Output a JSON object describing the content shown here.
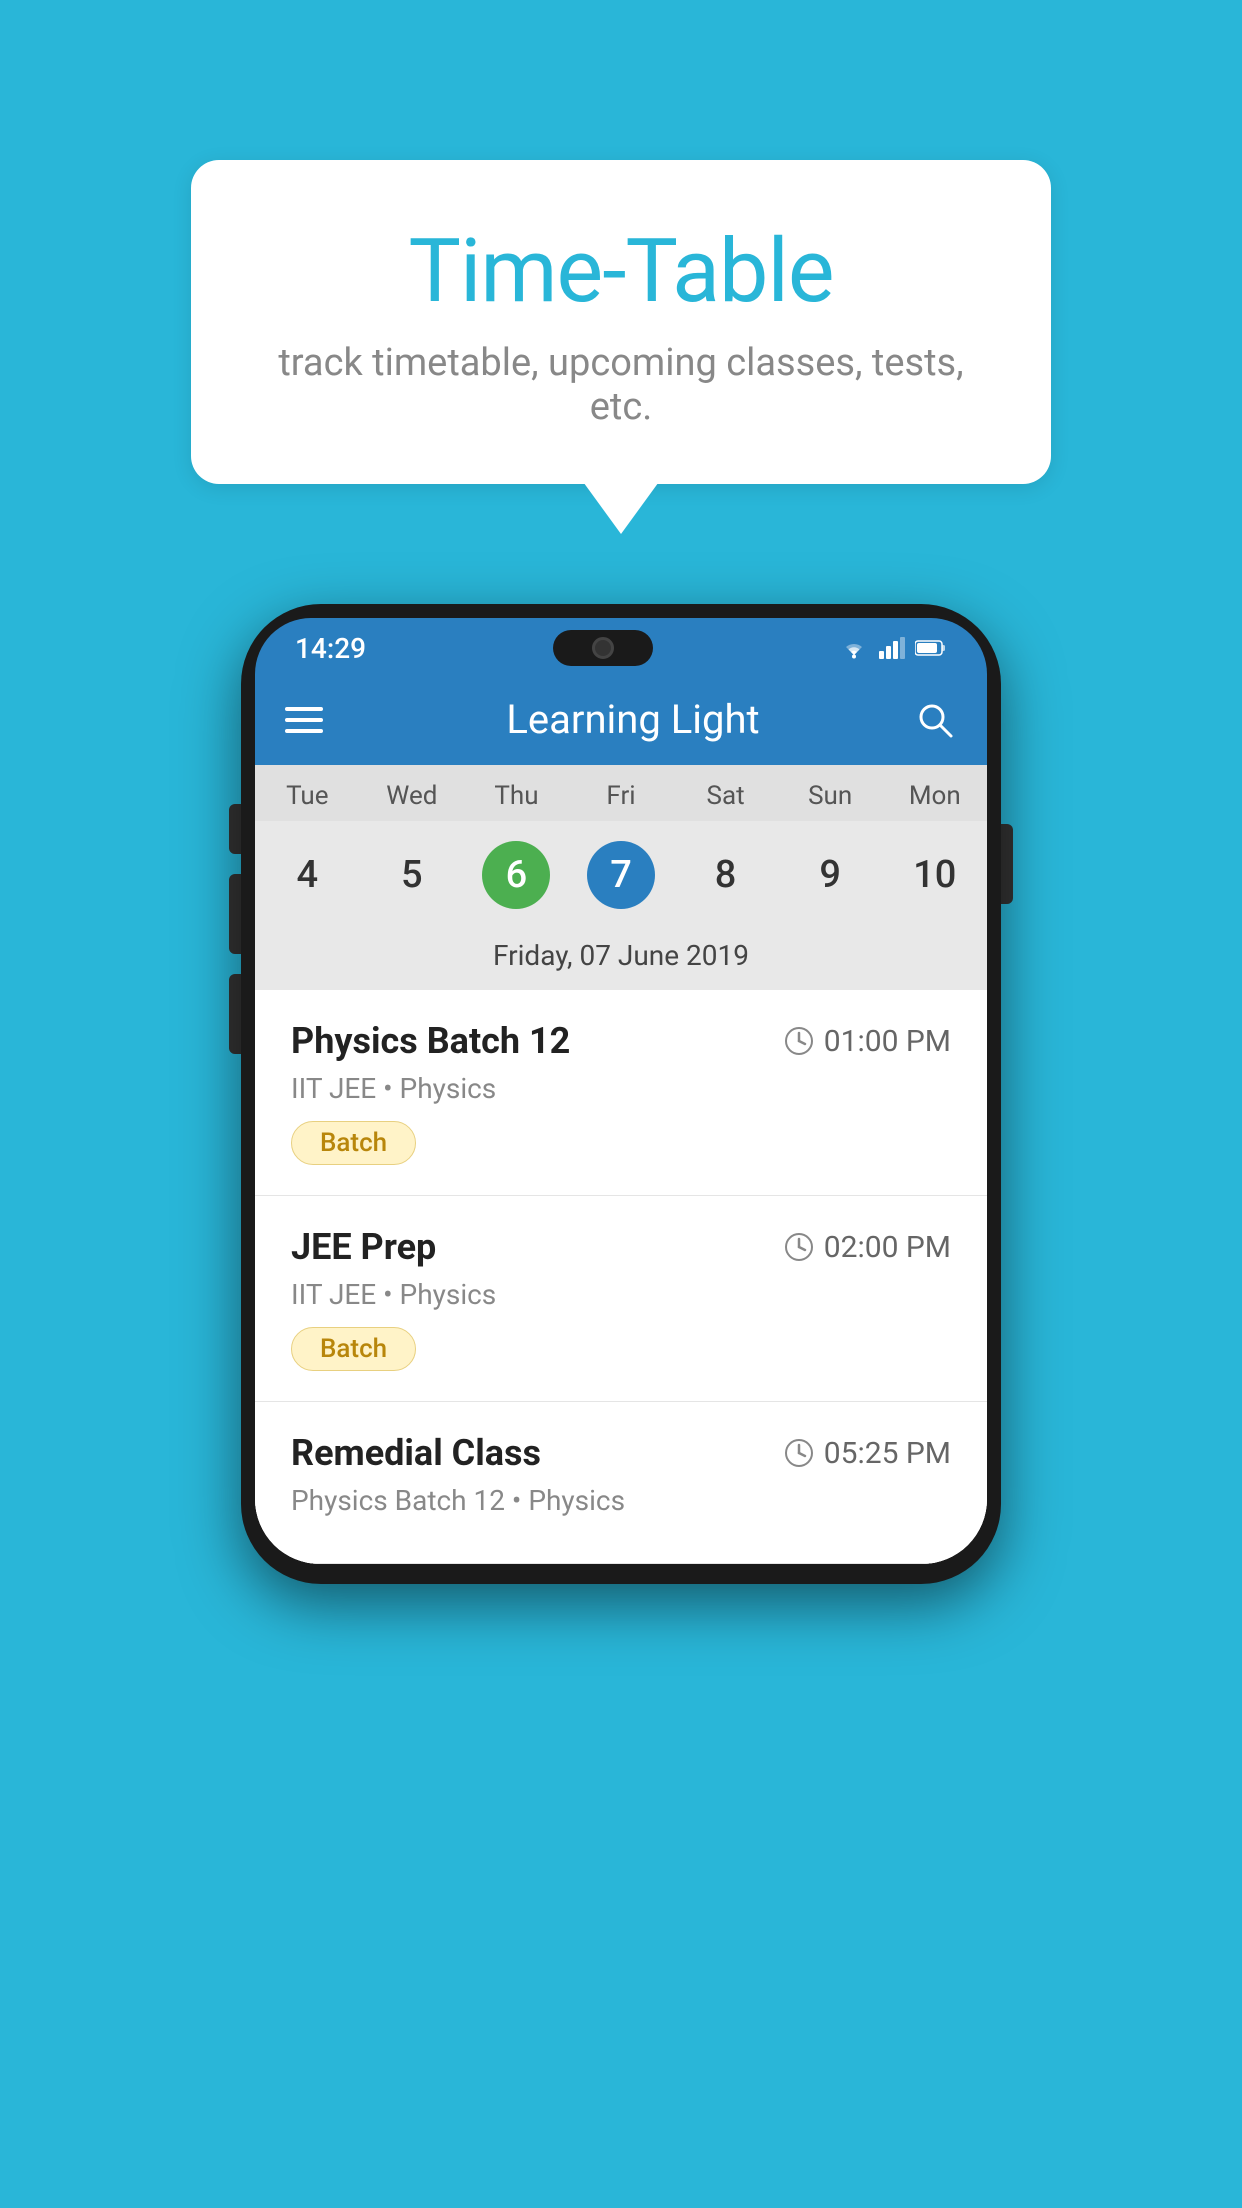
{
  "background_color": "#29B6D8",
  "speech_bubble": {
    "title": "Time-Table",
    "subtitle": "track timetable, upcoming classes, tests, etc."
  },
  "phone": {
    "status_bar": {
      "time": "14:29",
      "icons": [
        "wifi",
        "signal",
        "battery"
      ]
    },
    "app_header": {
      "title": "Learning Light"
    },
    "calendar": {
      "day_headers": [
        "Tue",
        "Wed",
        "Thu",
        "Fri",
        "Sat",
        "Sun",
        "Mon"
      ],
      "day_numbers": [
        "4",
        "5",
        "6",
        "7",
        "8",
        "9",
        "10"
      ],
      "today_index": 2,
      "selected_index": 3,
      "selected_date_label": "Friday, 07 June 2019"
    },
    "schedule_items": [
      {
        "name": "Physics Batch 12",
        "time": "01:00 PM",
        "sub": "IIT JEE • Physics",
        "tag": "Batch"
      },
      {
        "name": "JEE Prep",
        "time": "02:00 PM",
        "sub": "IIT JEE • Physics",
        "tag": "Batch"
      },
      {
        "name": "Remedial Class",
        "time": "05:25 PM",
        "sub": "Physics Batch 12 • Physics",
        "tag": null
      }
    ]
  }
}
